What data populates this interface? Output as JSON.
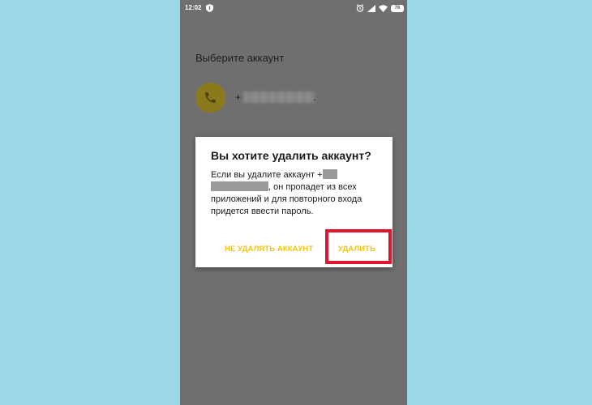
{
  "status_bar": {
    "time": "12:02",
    "battery": "76",
    "icons": [
      "shield-icon",
      "alarm-icon",
      "wifi-icon",
      "signal-icon",
      "battery-icon"
    ]
  },
  "screen": {
    "title": "Выберите аккаунт",
    "account": {
      "number_prefix": "+",
      "number_suffix": ".",
      "icon": "phone-icon"
    }
  },
  "dialog": {
    "title": "Вы хотите удалить аккаунт?",
    "body_start": "Если вы удалите аккаунт +",
    "body_end": ", он пропадет из всех приложений и для повторного входа придется ввести пароль.",
    "cancel_label": "НЕ УДАЛЯТЬ АККАУНТ",
    "confirm_label": "УДАЛИТЬ"
  },
  "colors": {
    "background": "#9bd8e8",
    "overlay": "#6f6f6f",
    "accent": "#f2c20c",
    "highlight": "#e2142d",
    "avatar": "#8b7a1c"
  }
}
